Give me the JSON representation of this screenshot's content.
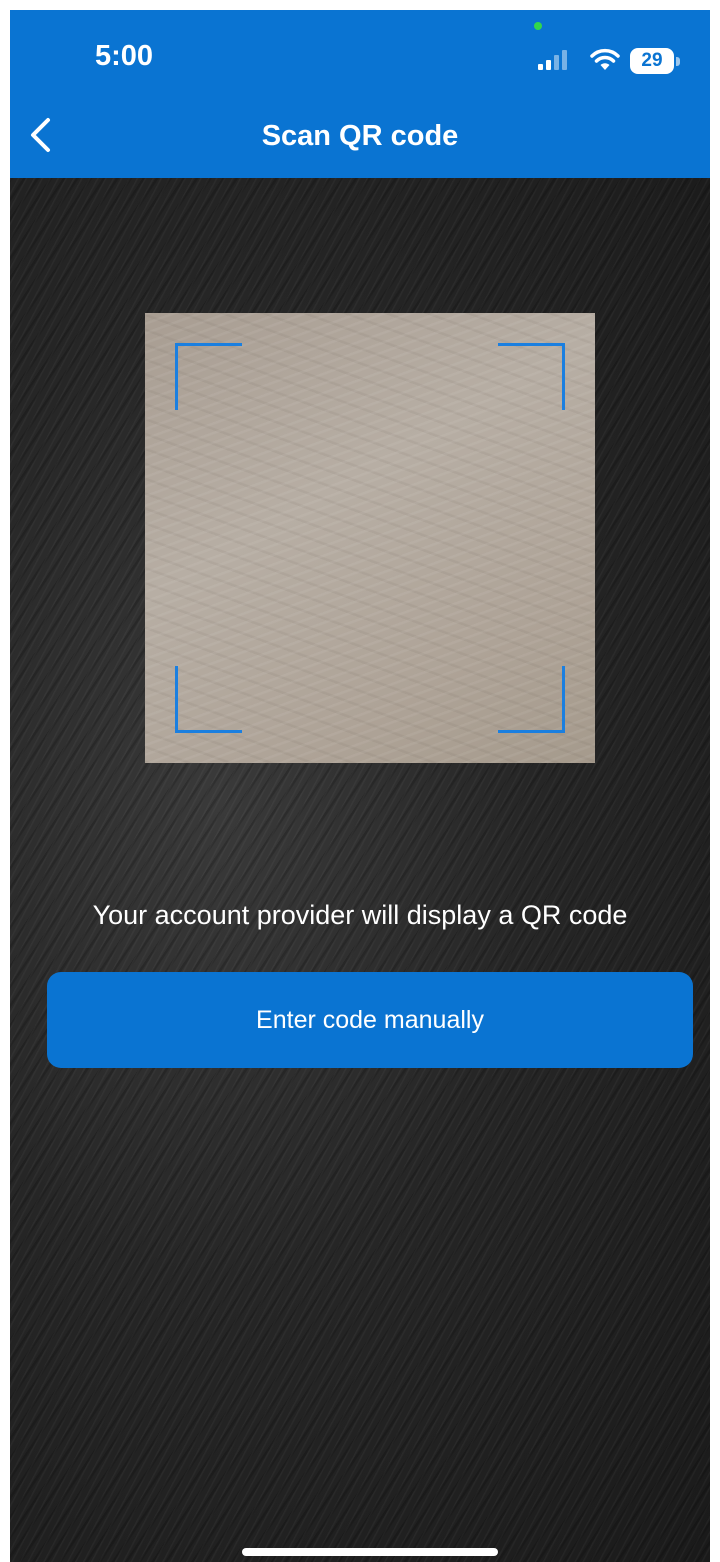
{
  "status_bar": {
    "time": "5:00",
    "battery_level": "29",
    "icons": [
      "signal-icon",
      "wifi-icon",
      "battery-icon"
    ]
  },
  "nav": {
    "title": "Scan QR code",
    "back_icon": "chevron-left-icon"
  },
  "scanner": {
    "instruction": "Your account provider will display a QR code",
    "accent_color": "#1a7fe0"
  },
  "actions": {
    "manual_entry_label": "Enter code manually"
  },
  "colors": {
    "brand": "#0a74d2",
    "background": "#1c1c1c"
  }
}
